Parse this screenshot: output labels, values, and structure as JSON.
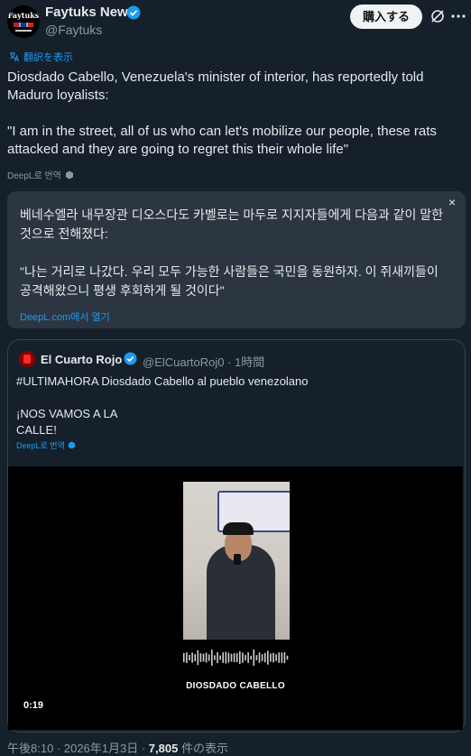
{
  "header": {
    "avatar_text": "Faytuks",
    "name": "Faytuks News",
    "handle": "@Faytuks",
    "buy_label": "購入する"
  },
  "translate_label": "翻訳を表示",
  "tweet_text": "Diosdado Cabello, Venezuela's minister of interior, has reportedly told Maduro loyalists:\n\n\"I am in the street, all of us who can let's mobilize our people, these rats attacked and they are going to regret this their whole life\"",
  "deepl_label": "DeepL로 번역",
  "translation": {
    "text": "베네수엘라 내무장관 디오스다도 카벨로는 마두로 지지자들에게 다음과 같이 말한 것으로 전해졌다:\n\n\"나는 거리로 나갔다. 우리 모두 가능한 사람들은 국민을 동원하자. 이 쥐새끼들이 공격해왔으니 평생 후회하게 될 것이다\"",
    "close": "×",
    "open_link": "DeepL.com에서 열기"
  },
  "quote": {
    "name": "El Cuarto Rojo",
    "meta": "@ElCuartoRoj0 · 1時間",
    "text": "#ULTIMAHORA Diosdado Cabello al pueblo venezolano\n\n¡NOS VAMOS A LA\nCALLE!",
    "deepl_label": "DeepL로 번역",
    "video": {
      "caption": "DIOSDADO CABELLO",
      "duration": "0:19"
    }
  },
  "footer": {
    "datetime": "午後8:10 · 2026年1月3日 · ",
    "views": "7,805",
    "views_label": " 件の表示"
  },
  "colors": {
    "background": "#15202b",
    "accent": "#1d9bf0",
    "muted": "#8b98a5"
  }
}
